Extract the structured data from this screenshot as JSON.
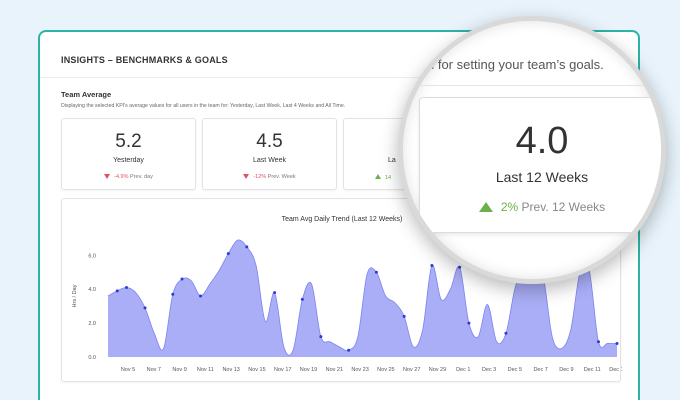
{
  "panel": {
    "title": "INSIGHTS – BENCHMARKS & GOALS",
    "subtitle": "d for setting your team’s goals."
  },
  "section": {
    "title": "Team Average",
    "description": "Displaying the selected KPI's average values for all users in the team for: Yesterday, Last Week, Last 4 Weeks and All Time."
  },
  "kpis": [
    {
      "value": "5.2",
      "label": "Yesterday",
      "change_pct": "-4.9%",
      "change_text": " Prev. day",
      "direction": "down"
    },
    {
      "value": "4.5",
      "label": "Last Week",
      "change_pct": "-12%",
      "change_text": " Prev. Week",
      "direction": "down"
    },
    {
      "value": "",
      "label": "La",
      "change_pct": "14",
      "change_text": "",
      "direction": "up"
    }
  ],
  "magnified": {
    "subtitle": "d for setting your team’s goals.",
    "value": "4.0",
    "label": "Last 12 Weeks",
    "change_pct": "2%",
    "change_text": " Prev. 12 Weeks",
    "direction": "up"
  },
  "colors": {
    "accent": "#2cb3a6",
    "area_fill": "#a9aef6",
    "area_stroke": "#7d84ee",
    "point": "#2d3bd6",
    "down": "#e05260",
    "up": "#6ab04c"
  },
  "chart_data": {
    "type": "area",
    "title": "Team Avg Daily Trend (Last 12 Weeks)",
    "ylabel": "Hrs / Day",
    "ylim": [
      0,
      7.2
    ],
    "yticks": [
      "0.0",
      "2.0",
      "4.0",
      "6.0"
    ],
    "xtick_labels": [
      "Nov 5",
      "Nov 7",
      "Nov 9",
      "Nov 11",
      "Nov 13",
      "Nov 15",
      "Nov 17",
      "Nov 19",
      "Nov 21",
      "Nov 23",
      "Nov 25",
      "Nov 27",
      "Nov 29",
      "Dec 1",
      "Dec 3",
      "Dec 5",
      "Dec 7",
      "Dec 9",
      "Dec 11",
      "Dec 13"
    ],
    "values": [
      3.6,
      3.9,
      4.1,
      3.8,
      2.9,
      1.4,
      0.5,
      3.7,
      4.6,
      4.5,
      3.6,
      4.3,
      5.1,
      6.1,
      6.9,
      6.5,
      5.4,
      2.1,
      3.8,
      0.6,
      0.4,
      3.4,
      4.3,
      1.2,
      0.9,
      0.6,
      0.4,
      1.2,
      4.9,
      5.0,
      3.6,
      3.2,
      2.4,
      0.6,
      1.6,
      5.4,
      3.4,
      4.0,
      5.3,
      2.0,
      1.2,
      3.1,
      0.9,
      1.4,
      4.1,
      5.2,
      5.0,
      4.8,
      1.2,
      0.5,
      1.6,
      5.0,
      5.1,
      0.9,
      0.8,
      0.8
    ],
    "marked_points": [
      1,
      2,
      4,
      7,
      8,
      10,
      13,
      15,
      18,
      21,
      23,
      26,
      29,
      32,
      35,
      38,
      39,
      43,
      53,
      55
    ],
    "grid": false,
    "legend": "none"
  }
}
